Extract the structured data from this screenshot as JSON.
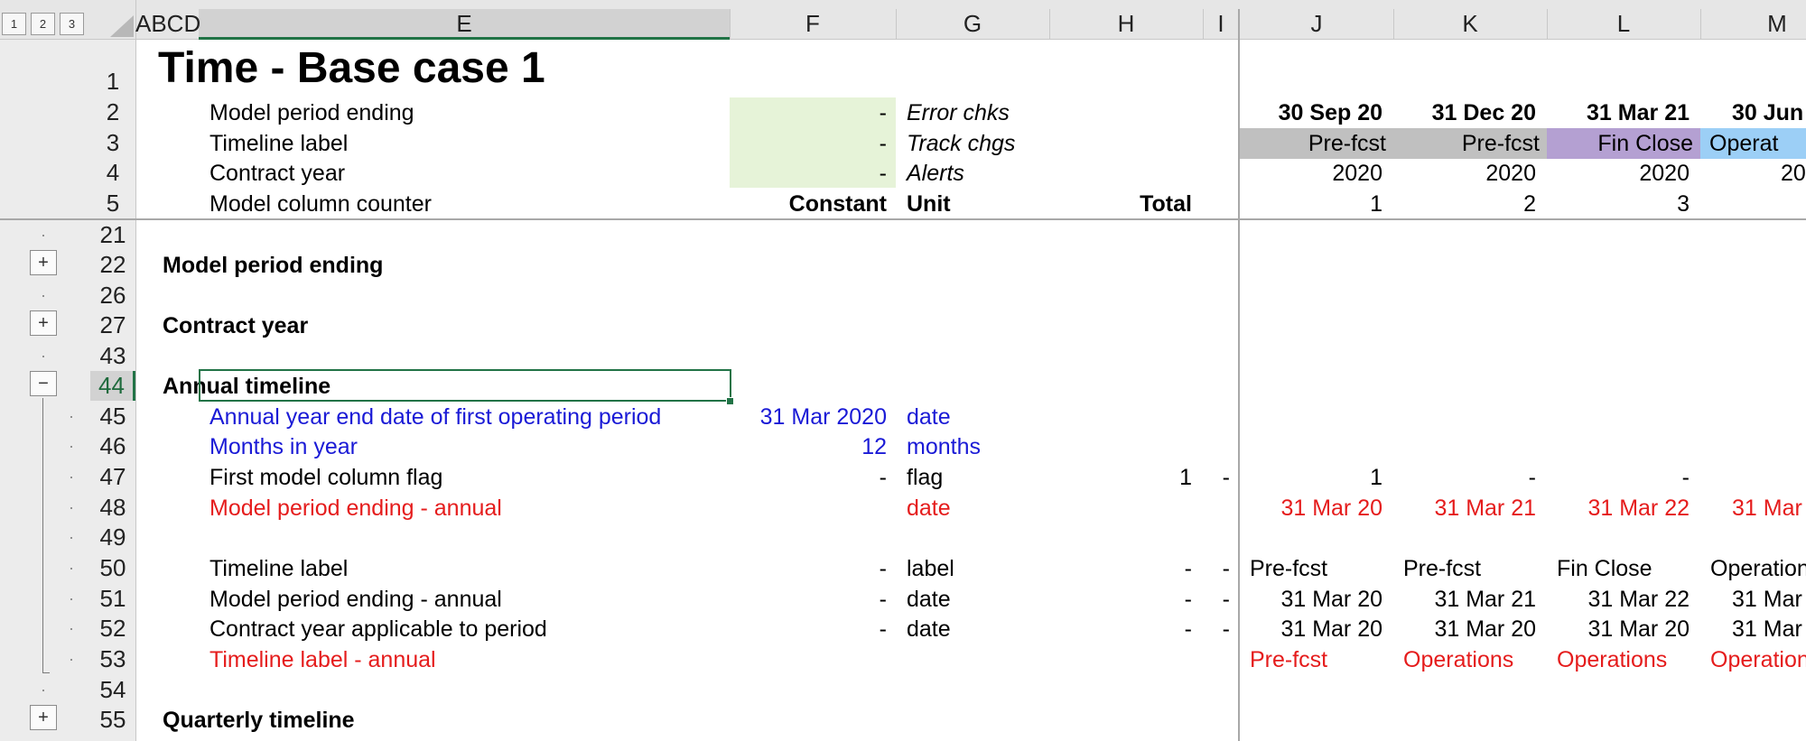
{
  "outline_levels": [
    "1",
    "2",
    "3"
  ],
  "columns": {
    "abcd": "ABCD",
    "e": "E",
    "f": "F",
    "g": "G",
    "h": "H",
    "i": "I",
    "j": "J",
    "k": "K",
    "l": "L",
    "m": "M"
  },
  "rows": [
    "1",
    "2",
    "3",
    "4",
    "5",
    "21",
    "22",
    "26",
    "27",
    "43",
    "44",
    "45",
    "46",
    "47",
    "48",
    "49",
    "50",
    "51",
    "52",
    "53",
    "54",
    "55"
  ],
  "outline_buttons": {
    "expand": "+",
    "collapse": "−"
  },
  "header": {
    "title": "Time - Base case 1",
    "r2": {
      "label": "Model period ending",
      "f": "-",
      "g": "Error chks"
    },
    "r3": {
      "label": "Timeline label",
      "f": "-",
      "g": "Track chgs"
    },
    "r4": {
      "label": "Contract year",
      "f": "-",
      "g": "Alerts"
    },
    "r5": {
      "label": "Model column counter",
      "f": "Constant",
      "g": "Unit",
      "h": "Total"
    },
    "periods": [
      {
        "date": "30 Sep 20",
        "label": "Pre-fcst",
        "year": "2020",
        "counter": "1"
      },
      {
        "date": "31 Dec 20",
        "label": "Pre-fcst",
        "year": "2020",
        "counter": "2"
      },
      {
        "date": "31 Mar 21",
        "label": "Fin Close",
        "year": "2020",
        "counter": "3"
      },
      {
        "date": "30 Jun",
        "label": "Operat",
        "year": "20",
        "counter": ""
      }
    ]
  },
  "sections": {
    "model_period_ending": "Model period ending",
    "contract_year": "Contract year",
    "annual_timeline": "Annual timeline",
    "quarterly_timeline": "Quarterly timeline"
  },
  "body": {
    "r45": {
      "label": "Annual year end date of first operating period",
      "f": "31 Mar 2020",
      "g": "date"
    },
    "r46": {
      "label": "Months in year",
      "f": "12",
      "g": "months"
    },
    "r47": {
      "label": "First model column flag",
      "f": "-",
      "g": "flag",
      "h": "1",
      "i": "-",
      "j": "1",
      "k": "-",
      "l": "-"
    },
    "r48": {
      "label": "Model period ending - annual",
      "g": "date",
      "j": "31 Mar 20",
      "k": "31 Mar 21",
      "l": "31 Mar 22",
      "m": "31 Mar"
    },
    "r50": {
      "label": "Timeline label",
      "f": "-",
      "g": "label",
      "h": "-",
      "i": "-",
      "j": "Pre-fcst",
      "k": "Pre-fcst",
      "l": "Fin Close",
      "m": "Operation"
    },
    "r51": {
      "label": "Model period ending - annual",
      "f": "-",
      "g": "date",
      "h": "-",
      "i": "-",
      "j": "31 Mar 20",
      "k": "31 Mar 21",
      "l": "31 Mar 22",
      "m": "31 Mar"
    },
    "r52": {
      "label": "Contract year applicable to period",
      "f": "-",
      "g": "date",
      "h": "-",
      "i": "-",
      "j": "31 Mar 20",
      "k": "31 Mar 20",
      "l": "31 Mar 20",
      "m": "31 Mar"
    },
    "r53": {
      "label": "Timeline label - annual",
      "j": "Pre-fcst",
      "k": "Operations",
      "l": "Operations",
      "m": "Operation"
    }
  },
  "colors": {
    "input_blue": "#1a1ad6",
    "calc_red": "#e51c1c",
    "selection_green": "#217346"
  }
}
